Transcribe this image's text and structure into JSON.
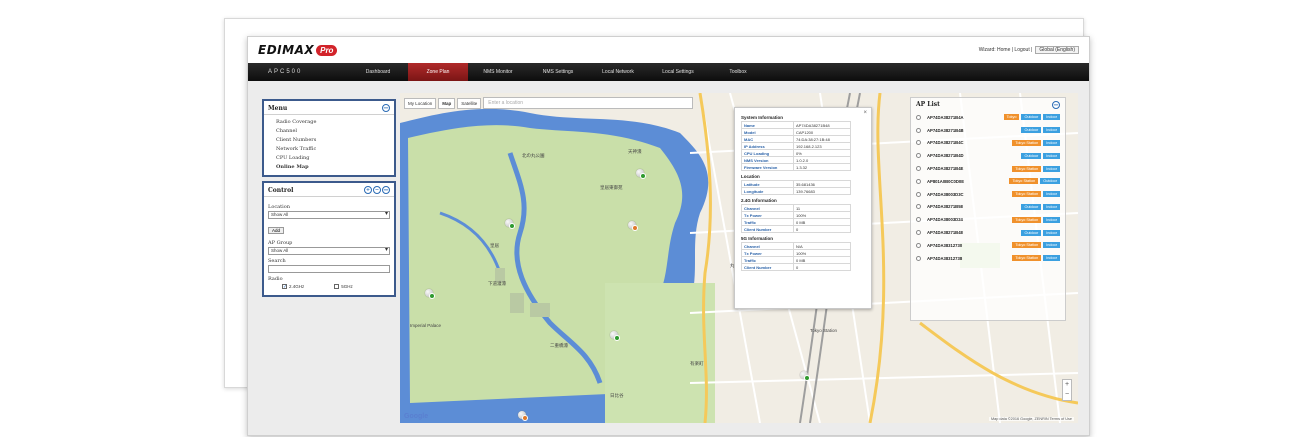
{
  "header": {
    "brand": "EDIMAX",
    "brand_pro": "Pro",
    "top_links": "Wizard: Home | Logout |",
    "language": "Global (English)"
  },
  "nav": {
    "model": "APC500",
    "items": [
      {
        "label": "Dashboard",
        "active": false
      },
      {
        "label": "Zone Plan",
        "active": true
      },
      {
        "label": "NMS Monitor",
        "active": false
      },
      {
        "label": "NMS Settings",
        "active": false
      },
      {
        "label": "Local Network",
        "active": false
      },
      {
        "label": "Local Settings",
        "active": false
      },
      {
        "label": "Toolbox",
        "active": false
      }
    ]
  },
  "menu": {
    "title": "Menu",
    "items": [
      {
        "label": "Radio Coverage",
        "active": false
      },
      {
        "label": "Channel",
        "active": false
      },
      {
        "label": "Client Numbers",
        "active": false
      },
      {
        "label": "Network Traffic",
        "active": false
      },
      {
        "label": "CPU Loading",
        "active": false
      },
      {
        "label": "Online Map",
        "active": true
      }
    ]
  },
  "control": {
    "title": "Control",
    "location_label": "Location",
    "location_value": "Show All",
    "add_label": "Add",
    "ap_group_label": "AP Group",
    "ap_group_value": "Show All",
    "search_label": "Search",
    "radio_label": "Radio",
    "radio_24": "2.4GHz",
    "radio_5": "5GHz"
  },
  "map": {
    "my_location": "My Location",
    "map_btn": "Map",
    "satellite_btn": "Satellite",
    "search_placeholder": "Enter a location",
    "footer": "Map data ©2016 Google, ZENRIN   Terms of Use",
    "google": "Google",
    "labels": {
      "a": "北の丸公園",
      "b": "皇居東御苑",
      "c": "天神濠",
      "d": "皇居",
      "e": "下道灌濠",
      "f": "二重橋濠",
      "g": "Imperial Palace",
      "h": "丸の内",
      "i": "Tokyo Station",
      "j": "有楽町",
      "k": "日比谷"
    }
  },
  "info": {
    "system_title": "System Information",
    "system": [
      {
        "k": "Name",
        "v": "AP74DA38271B48"
      },
      {
        "k": "Model",
        "v": "CAP1200"
      },
      {
        "k": "MAC",
        "v": "74:DA:38:27:1B:48"
      },
      {
        "k": "IP Address",
        "v": "192.168.2.123"
      },
      {
        "k": "CPU Loading",
        "v": "0%"
      },
      {
        "k": "NMS Version",
        "v": "1.0.2.0"
      },
      {
        "k": "Firmware Version",
        "v": "1.3.32"
      }
    ],
    "location_title": "Location",
    "location": [
      {
        "k": "Latitude",
        "v": "35.681436"
      },
      {
        "k": "Longitude",
        "v": "139.76683"
      }
    ],
    "g24_title": "2.4G Information",
    "g24": [
      {
        "k": "Channel",
        "v": "11"
      },
      {
        "k": "Tx Power",
        "v": "100%"
      },
      {
        "k": "Traffic",
        "v": "0 MB"
      },
      {
        "k": "Client Number",
        "v": "0"
      }
    ],
    "g5_title": "5G Information",
    "g5": [
      {
        "k": "Channel",
        "v": "N/A"
      },
      {
        "k": "Tx Power",
        "v": "100%"
      },
      {
        "k": "Traffic",
        "v": "0 MB"
      },
      {
        "k": "Client Number",
        "v": "0"
      }
    ]
  },
  "ap_list": {
    "title": "AP List",
    "rows": [
      {
        "name": "AP74DA38271B4A",
        "chips": [
          {
            "label": "Tokyo",
            "color": "orange"
          },
          {
            "label": "Outdoor",
            "color": "blue"
          },
          {
            "label": "Indoor",
            "color": "blue"
          }
        ]
      },
      {
        "name": "AP74DA38271B4B",
        "chips": [
          {
            "label": "Outdoor",
            "color": "blue"
          },
          {
            "label": "Indoor",
            "color": "blue"
          }
        ]
      },
      {
        "name": "AP74DA38271B4C",
        "chips": [
          {
            "label": "Tokyo Station",
            "color": "orange"
          },
          {
            "label": "Indoor",
            "color": "blue"
          }
        ]
      },
      {
        "name": "AP74DA38271B4D",
        "chips": [
          {
            "label": "Outdoor",
            "color": "blue"
          },
          {
            "label": "Indoor",
            "color": "blue"
          }
        ]
      },
      {
        "name": "AP74DA38271B4E",
        "chips": [
          {
            "label": "Tokyo Station",
            "color": "orange"
          },
          {
            "label": "Indoor",
            "color": "blue"
          }
        ]
      },
      {
        "name": "AP801A0B0C0D0E",
        "chips": [
          {
            "label": "Tokyo Station",
            "color": "orange"
          },
          {
            "label": "Outdoor",
            "color": "blue"
          }
        ]
      },
      {
        "name": "AP74DA38003D3C",
        "chips": [
          {
            "label": "Tokyo Station",
            "color": "orange"
          },
          {
            "label": "Indoor",
            "color": "blue"
          }
        ]
      },
      {
        "name": "AP74DA38271B58",
        "chips": [
          {
            "label": "Outdoor",
            "color": "blue"
          },
          {
            "label": "Indoor",
            "color": "blue"
          }
        ]
      },
      {
        "name": "AP74DA38003D24",
        "chips": [
          {
            "label": "Tokyo Station",
            "color": "orange"
          },
          {
            "label": "Indoor",
            "color": "blue"
          }
        ]
      },
      {
        "name": "AP74DA38271B48",
        "chips": [
          {
            "label": "Outdoor",
            "color": "blue"
          },
          {
            "label": "Indoor",
            "color": "blue"
          }
        ]
      },
      {
        "name": "AP74DA38312730",
        "chips": [
          {
            "label": "Tokyo Station",
            "color": "orange"
          },
          {
            "label": "Indoor",
            "color": "blue"
          }
        ]
      },
      {
        "name": "AP74DA38312738",
        "chips": [
          {
            "label": "Tokyo Station",
            "color": "orange"
          },
          {
            "label": "Indoor",
            "color": "blue"
          }
        ]
      }
    ]
  },
  "colors": {
    "nav_active": "#9b2020",
    "panel_border": "#3c5a8c",
    "chip_orange": "#f0912c",
    "chip_blue": "#3ba0e0",
    "water": "#5c8dd6",
    "park": "#c9dfa9"
  }
}
